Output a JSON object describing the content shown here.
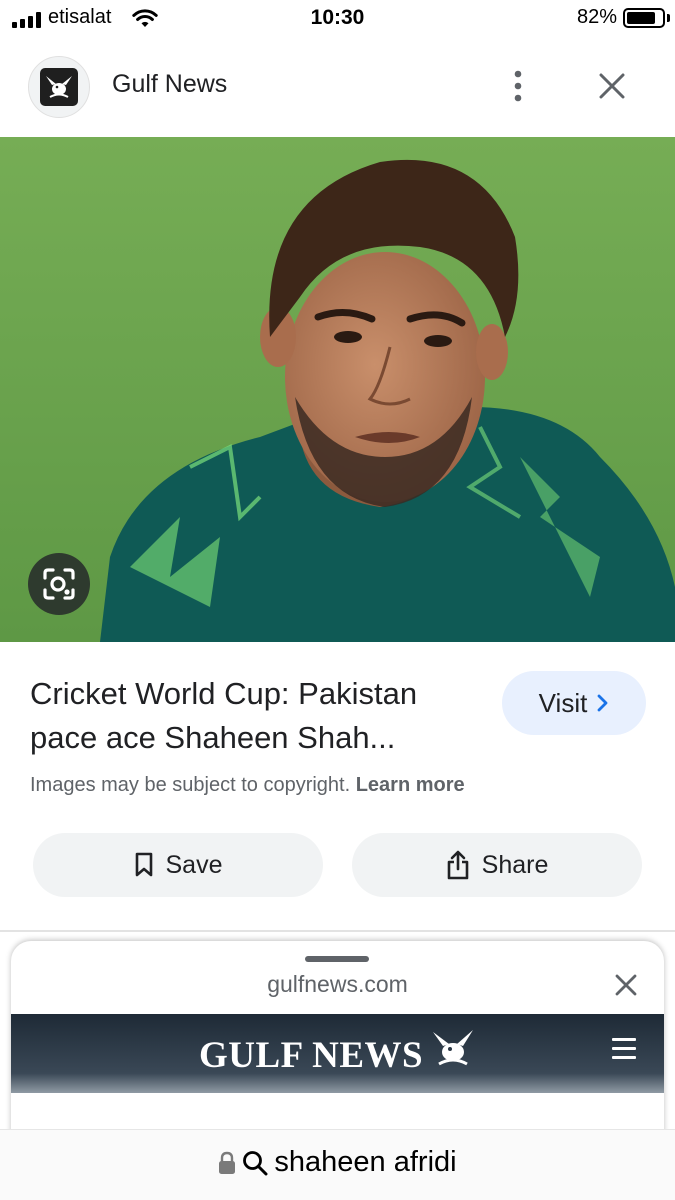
{
  "status_bar": {
    "carrier": "etisalat",
    "time": "10:30",
    "battery_percent_label": "82%",
    "battery_level": 0.82
  },
  "header": {
    "site_name": "Gulf News",
    "icons": [
      "gulf-news-logo",
      "more-vert-icon",
      "close-icon"
    ]
  },
  "result": {
    "title": "Cricket World Cup: Pakistan pace ace Shaheen Shah...",
    "visit_label": "Visit",
    "copyright_text": "Images may be subject to copyright.",
    "learn_more": "Learn more",
    "save_label": "Save",
    "share_label": "Share"
  },
  "sheet": {
    "domain": "gulfnews.com",
    "brand": "GULF NEWS"
  },
  "address_bar": {
    "query": "shaheen afridi"
  },
  "colors": {
    "visit_bg": "#e8f0fe",
    "chevron": "#1a73e8",
    "pill_bg": "#f1f3f4",
    "grass": "#6aa84f",
    "jersey": "#0f5a55",
    "banner": "#1e2a36"
  }
}
